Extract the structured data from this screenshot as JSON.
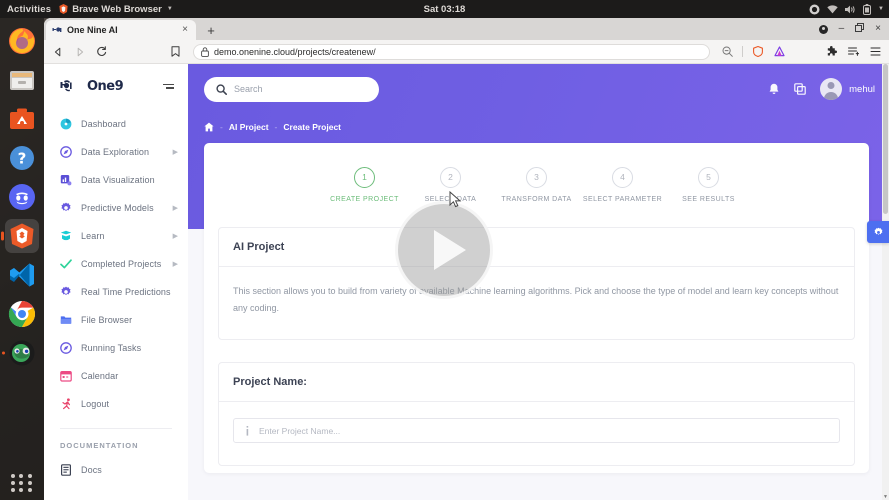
{
  "os": {
    "activities": "Activities",
    "active_app": "Brave Web Browser",
    "clock": "Sat 03:18",
    "tray_icons": [
      "recording-icon",
      "wifi-icon",
      "volume-icon",
      "battery-icon",
      "chevron-down-icon"
    ],
    "dock": [
      {
        "name": "firefox",
        "label": "Firefox"
      },
      {
        "name": "files",
        "label": "Files"
      },
      {
        "name": "ubuntu-software",
        "label": "Ubuntu Software"
      },
      {
        "name": "help",
        "label": "Help"
      },
      {
        "name": "discord",
        "label": "Discord"
      },
      {
        "name": "brave",
        "label": "Brave Web Browser"
      },
      {
        "name": "vscode",
        "label": "Visual Studio Code"
      },
      {
        "name": "chrome",
        "label": "Google Chrome"
      },
      {
        "name": "gimp",
        "label": "GIMP"
      }
    ],
    "show_apps": "Show Applications"
  },
  "browser": {
    "tab": {
      "title": "One Nine AI",
      "close_label": "×",
      "favicon": "onenine-favicon"
    },
    "new_tab_label": "+",
    "window_controls": {
      "minimize": "–",
      "maximize": "❐",
      "close": "×"
    },
    "nav": {
      "back": "◁",
      "forward": "▷",
      "reload": "⟳",
      "bookmark": "bookmark-icon"
    },
    "url": "demo.onenine.cloud/projects/createnew/",
    "url_secure_icon": "lock-icon",
    "toolbar_right": [
      "zoom-out-icon",
      "brave-shield-icon",
      "brave-rewards-icon",
      "extensions-icon",
      "reading-list-icon",
      "browser-menu-icon"
    ]
  },
  "sidebar": {
    "logo_text": "One9",
    "menu_toggle": "hamburger-icon",
    "items": [
      {
        "label": "Dashboard",
        "icon": "dashboard-icon",
        "color": "#2fc6e0",
        "arrow": false
      },
      {
        "label": "Data Exploration",
        "icon": "compass-icon",
        "color": "#6a5ae0",
        "arrow": true
      },
      {
        "label": "Data Visualization",
        "icon": "chart-icon",
        "color": "#5b4fd6",
        "arrow": false
      },
      {
        "label": "Predictive Models",
        "icon": "gear-icon",
        "color": "#6a5ae0",
        "arrow": true
      },
      {
        "label": "Learn",
        "icon": "book-icon",
        "color": "#19cdd4",
        "arrow": true
      },
      {
        "label": "Completed Projects",
        "icon": "check-icon",
        "color": "#2ed39a",
        "arrow": true
      },
      {
        "label": "Real Time Predictions",
        "icon": "gear-alt-icon",
        "color": "#6a5ae0",
        "arrow": false
      },
      {
        "label": "File Browser",
        "icon": "folder-icon",
        "color": "#4d6ff0",
        "arrow": false
      },
      {
        "label": "Running Tasks",
        "icon": "compass-alt-icon",
        "color": "#6a5ae0",
        "arrow": false
      },
      {
        "label": "Calendar",
        "icon": "calendar-icon",
        "color": "#ec4a84",
        "arrow": false
      },
      {
        "label": "Logout",
        "icon": "logout-icon",
        "color": "#e8436a",
        "arrow": false
      }
    ],
    "section_title": "DOCUMENTATION",
    "docs": {
      "label": "Docs",
      "icon": "docs-icon",
      "color": "#3d4354"
    }
  },
  "app": {
    "search": {
      "placeholder": "Search",
      "icon": "search-icon"
    },
    "header_icons": [
      "bell-icon",
      "copy-icon"
    ],
    "user": {
      "name": "mehul",
      "avatar": "user-avatar"
    },
    "breadcrumb": {
      "home_icon": "home-icon",
      "items": [
        "AI Project",
        "Create Project"
      ],
      "separator": "-"
    },
    "stepper": [
      {
        "num": "1",
        "label": "CREATE PROJECT",
        "active": true
      },
      {
        "num": "2",
        "label": "SELECT DATA",
        "active": false
      },
      {
        "num": "3",
        "label": "TRANSFORM DATA",
        "active": false
      },
      {
        "num": "4",
        "label": "SELECT PARAMETER",
        "active": false
      },
      {
        "num": "5",
        "label": "SEE RESULTS",
        "active": false
      }
    ],
    "project_panel": {
      "title": "AI Project",
      "description": "This section allows you to build from variety of available Machine learning algorithms. Pick and choose the type of model and learn key concepts without any coding."
    },
    "name_panel": {
      "title": "Project Name:",
      "input_placeholder": "Enter Project Name...",
      "input_value": "",
      "input_icon": "info-icon"
    },
    "settings_tab": {
      "icon": "settings-gear-icon",
      "color": "#4d6ff0"
    },
    "video_overlay": {
      "icon": "play-icon"
    },
    "accent_color": "#6a5ae0",
    "active_step_color": "#6dbd7b"
  }
}
